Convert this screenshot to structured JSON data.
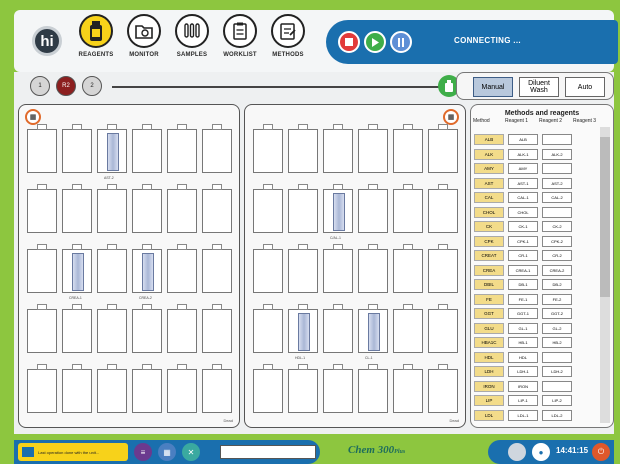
{
  "brand": {
    "logo_text": "hi",
    "product": "Chem",
    "model": "300"
  },
  "nav": [
    {
      "label": "REAGENTS",
      "icon": "reagent-bottle-icon",
      "active": true
    },
    {
      "label": "MONITOR",
      "icon": "monitor-folder-icon",
      "active": false
    },
    {
      "label": "SAMPLES",
      "icon": "sample-tubes-icon",
      "active": false
    },
    {
      "label": "WORKLIST",
      "icon": "worklist-clipboard-icon",
      "active": false
    },
    {
      "label": "METHODS",
      "icon": "methods-notepad-icon",
      "active": false
    }
  ],
  "status": {
    "text": "CONNECTING ...",
    "stop_color": "#e23a3a",
    "play_color": "#3fae49",
    "pause_color": "#5e8fd6"
  },
  "racks": {
    "buttons": [
      "1",
      "R2",
      "2"
    ],
    "selected": "R2"
  },
  "modes": [
    {
      "label": "Manual",
      "active": true
    },
    {
      "label": "Diluent Wash",
      "active": false
    },
    {
      "label": "Auto",
      "active": false
    }
  ],
  "left_rack": {
    "tubes": [
      {
        "slot": 3,
        "label": "AST-2"
      },
      {
        "slot": 14,
        "label": "CREA-1"
      },
      {
        "slot": 16,
        "label": "CREA-2"
      }
    ],
    "footer": "Dead"
  },
  "right_rack": {
    "tubes": [
      {
        "slot": 9,
        "label": "C/AL-1"
      },
      {
        "slot": 20,
        "label": "HDL-1"
      },
      {
        "slot": 22,
        "label": "CL-1"
      }
    ],
    "footer": "Dead"
  },
  "methods": {
    "title": "Methods and reagents",
    "headers": [
      "Method",
      "Reagent 1",
      "Reagent 2",
      "Reagent 3"
    ],
    "rows": [
      {
        "code": "ALB",
        "r1": "ALB",
        "r2": ""
      },
      {
        "code": "ALK",
        "r1": "ALK-1",
        "r2": "ALK-2"
      },
      {
        "code": "AMY",
        "r1": "AMY",
        "r2": ""
      },
      {
        "code": "AST",
        "r1": "AST-1",
        "r2": "AST-2"
      },
      {
        "code": "CAL",
        "r1": "CAL-1",
        "r2": "CAL-2"
      },
      {
        "code": "CHOL",
        "r1": "CHOL",
        "r2": ""
      },
      {
        "code": "CK",
        "r1": "CK-1",
        "r2": "CK-2"
      },
      {
        "code": "CPK",
        "r1": "CPK-1",
        "r2": "CPK-2"
      },
      {
        "code": "CREAT",
        "r1": "CR-1",
        "r2": "CR-2"
      },
      {
        "code": "CREA",
        "r1": "CREA-1",
        "r2": "CREA-2"
      },
      {
        "code": "DBIL",
        "r1": "DB-1",
        "r2": "DB-2"
      },
      {
        "code": "FE",
        "r1": "FE-1",
        "r2": "FE-2"
      },
      {
        "code": "GGT",
        "r1": "GGT-1",
        "r2": "GGT-2"
      },
      {
        "code": "GLU",
        "r1": "GL-1",
        "r2": "GL-2"
      },
      {
        "code": "HBA1C",
        "r1": "HB-1",
        "r2": "HB-2"
      },
      {
        "code": "HDL",
        "r1": "HDL",
        "r2": ""
      },
      {
        "code": "LDH",
        "r1": "LDH-1",
        "r2": "LDH-2"
      },
      {
        "code": "IRON",
        "r1": "IRON",
        "r2": ""
      },
      {
        "code": "LIP",
        "r1": "LIP-1",
        "r2": "LIP-2"
      },
      {
        "code": "LDL",
        "r1": "LDL-1",
        "r2": "LDL-2"
      }
    ]
  },
  "footer": {
    "warning": "Last operation done with the unit...",
    "time": "14:41:15",
    "power_color": "#e0582b"
  }
}
